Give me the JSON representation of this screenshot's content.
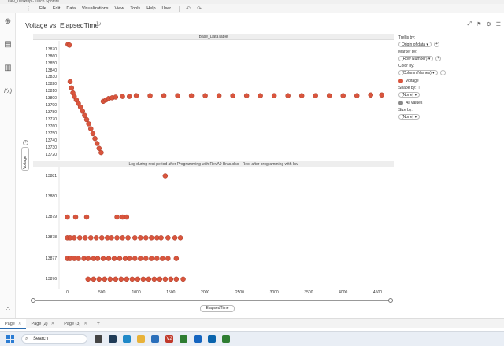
{
  "window": {
    "title": "Dev_Desktop - Tibco Spotfire"
  },
  "menu": {
    "items": [
      "File",
      "Edit",
      "Data",
      "Visualizations",
      "View",
      "Tools",
      "Help",
      "User"
    ]
  },
  "visualization": {
    "title": "Voltage vs. ElapsedTime"
  },
  "panels": {
    "top_title": "Base_DataTable",
    "bottom_title": "Log during rest period after Programming with RevA9 Brac.xlsx - Rest after programming with Inv"
  },
  "axes": {
    "y_label": "Voltage",
    "x_label": "ElapsedTime"
  },
  "legend": {
    "trellis_label": "Trellis by:",
    "trellis_value": "Origin of data",
    "marker_label": "Marker by:",
    "marker_value": "(Row Number)",
    "color_label": "Color by:",
    "color_value": "(Column Names)",
    "color_item": "Voltage",
    "color_item_color": "#d9553d",
    "shape_label": "Shape by:",
    "shape_value": "(None)",
    "shape_item": "All values",
    "size_label": "Size by:",
    "size_value": "(None)"
  },
  "tabs": [
    {
      "label": "Page",
      "active": true
    },
    {
      "label": "Page (2)",
      "active": false
    },
    {
      "label": "Page (3)",
      "active": false
    }
  ],
  "taskbar": {
    "search_placeholder": "Search"
  },
  "chart_data": {
    "type": "scatter",
    "x_label": "ElapsedTime",
    "y_label": "Voltage",
    "x_ticks": [
      0,
      500,
      1000,
      1500,
      2000,
      2500,
      3000,
      3500,
      4000,
      4500
    ],
    "xlim": [
      -120,
      4700
    ],
    "marker_color": "#d9553d",
    "panels": [
      {
        "title": "Base_DataTable",
        "ylim": [
          13713,
          13882
        ],
        "y_ticks": [
          13720,
          13730,
          13740,
          13750,
          13760,
          13770,
          13780,
          13790,
          13800,
          13810,
          13820,
          13830,
          13840,
          13850,
          13860,
          13870
        ],
        "series": [
          {
            "name": "Voltage",
            "points": [
              [
                10,
                13877
              ],
              [
                30,
                13876
              ],
              [
                40,
                13824
              ],
              [
                60,
                13815
              ],
              [
                80,
                13808
              ],
              [
                100,
                13803
              ],
              [
                130,
                13798
              ],
              [
                160,
                13793
              ],
              [
                190,
                13788
              ],
              [
                220,
                13782
              ],
              [
                250,
                13776
              ],
              [
                280,
                13770
              ],
              [
                310,
                13764
              ],
              [
                340,
                13757
              ],
              [
                370,
                13750
              ],
              [
                400,
                13743
              ],
              [
                430,
                13736
              ],
              [
                460,
                13729
              ],
              [
                490,
                13723
              ],
              [
                520,
                13796
              ],
              [
                560,
                13798
              ],
              [
                600,
                13800
              ],
              [
                650,
                13801
              ],
              [
                700,
                13802
              ],
              [
                800,
                13803
              ],
              [
                900,
                13803
              ],
              [
                1000,
                13804
              ],
              [
                1200,
                13804
              ],
              [
                1400,
                13804
              ],
              [
                1600,
                13804
              ],
              [
                1800,
                13804
              ],
              [
                2000,
                13804
              ],
              [
                2200,
                13804
              ],
              [
                2400,
                13804
              ],
              [
                2600,
                13804
              ],
              [
                2800,
                13804
              ],
              [
                3000,
                13804
              ],
              [
                3200,
                13804
              ],
              [
                3400,
                13804
              ],
              [
                3600,
                13804
              ],
              [
                3800,
                13804
              ],
              [
                4000,
                13804
              ],
              [
                4200,
                13804
              ],
              [
                4400,
                13805
              ],
              [
                4560,
                13805
              ]
            ]
          }
        ]
      },
      {
        "title": "Log during rest period after Programming with RevA9 Brac.xlsx - Rest after programming with Inv",
        "ylim": [
          13875.5,
          13881.4
        ],
        "y_ticks": [
          13876,
          13877,
          13878,
          13879,
          13880,
          13881
        ],
        "series": [
          {
            "name": "Voltage",
            "points": [
              [
                1420,
                13881
              ],
              [
                0,
                13879
              ],
              [
                120,
                13879
              ],
              [
                280,
                13879
              ],
              [
                720,
                13879
              ],
              [
                800,
                13879
              ],
              [
                860,
                13879
              ],
              [
                0,
                13878
              ],
              [
                40,
                13878
              ],
              [
                100,
                13878
              ],
              [
                180,
                13878
              ],
              [
                260,
                13878
              ],
              [
                340,
                13878
              ],
              [
                420,
                13878
              ],
              [
                500,
                13878
              ],
              [
                580,
                13878
              ],
              [
                640,
                13878
              ],
              [
                720,
                13878
              ],
              [
                800,
                13878
              ],
              [
                880,
                13878
              ],
              [
                980,
                13878
              ],
              [
                1060,
                13878
              ],
              [
                1140,
                13878
              ],
              [
                1220,
                13878
              ],
              [
                1300,
                13878
              ],
              [
                1360,
                13878
              ],
              [
                1460,
                13878
              ],
              [
                1560,
                13878
              ],
              [
                1640,
                13878
              ],
              [
                0,
                13877
              ],
              [
                40,
                13877
              ],
              [
                100,
                13877
              ],
              [
                160,
                13877
              ],
              [
                240,
                13877
              ],
              [
                300,
                13877
              ],
              [
                380,
                13877
              ],
              [
                440,
                13877
              ],
              [
                520,
                13877
              ],
              [
                600,
                13877
              ],
              [
                680,
                13877
              ],
              [
                760,
                13877
              ],
              [
                840,
                13877
              ],
              [
                900,
                13877
              ],
              [
                980,
                13877
              ],
              [
                1060,
                13877
              ],
              [
                1140,
                13877
              ],
              [
                1220,
                13877
              ],
              [
                1300,
                13877
              ],
              [
                1380,
                13877
              ],
              [
                1460,
                13877
              ],
              [
                1580,
                13877
              ],
              [
                300,
                13876
              ],
              [
                380,
                13876
              ],
              [
                460,
                13876
              ],
              [
                540,
                13876
              ],
              [
                620,
                13876
              ],
              [
                700,
                13876
              ],
              [
                780,
                13876
              ],
              [
                860,
                13876
              ],
              [
                940,
                13876
              ],
              [
                1020,
                13876
              ],
              [
                1100,
                13876
              ],
              [
                1180,
                13876
              ],
              [
                1260,
                13876
              ],
              [
                1340,
                13876
              ],
              [
                1420,
                13876
              ],
              [
                1500,
                13876
              ],
              [
                1580,
                13876
              ],
              [
                1680,
                13876
              ]
            ]
          }
        ]
      }
    ]
  }
}
